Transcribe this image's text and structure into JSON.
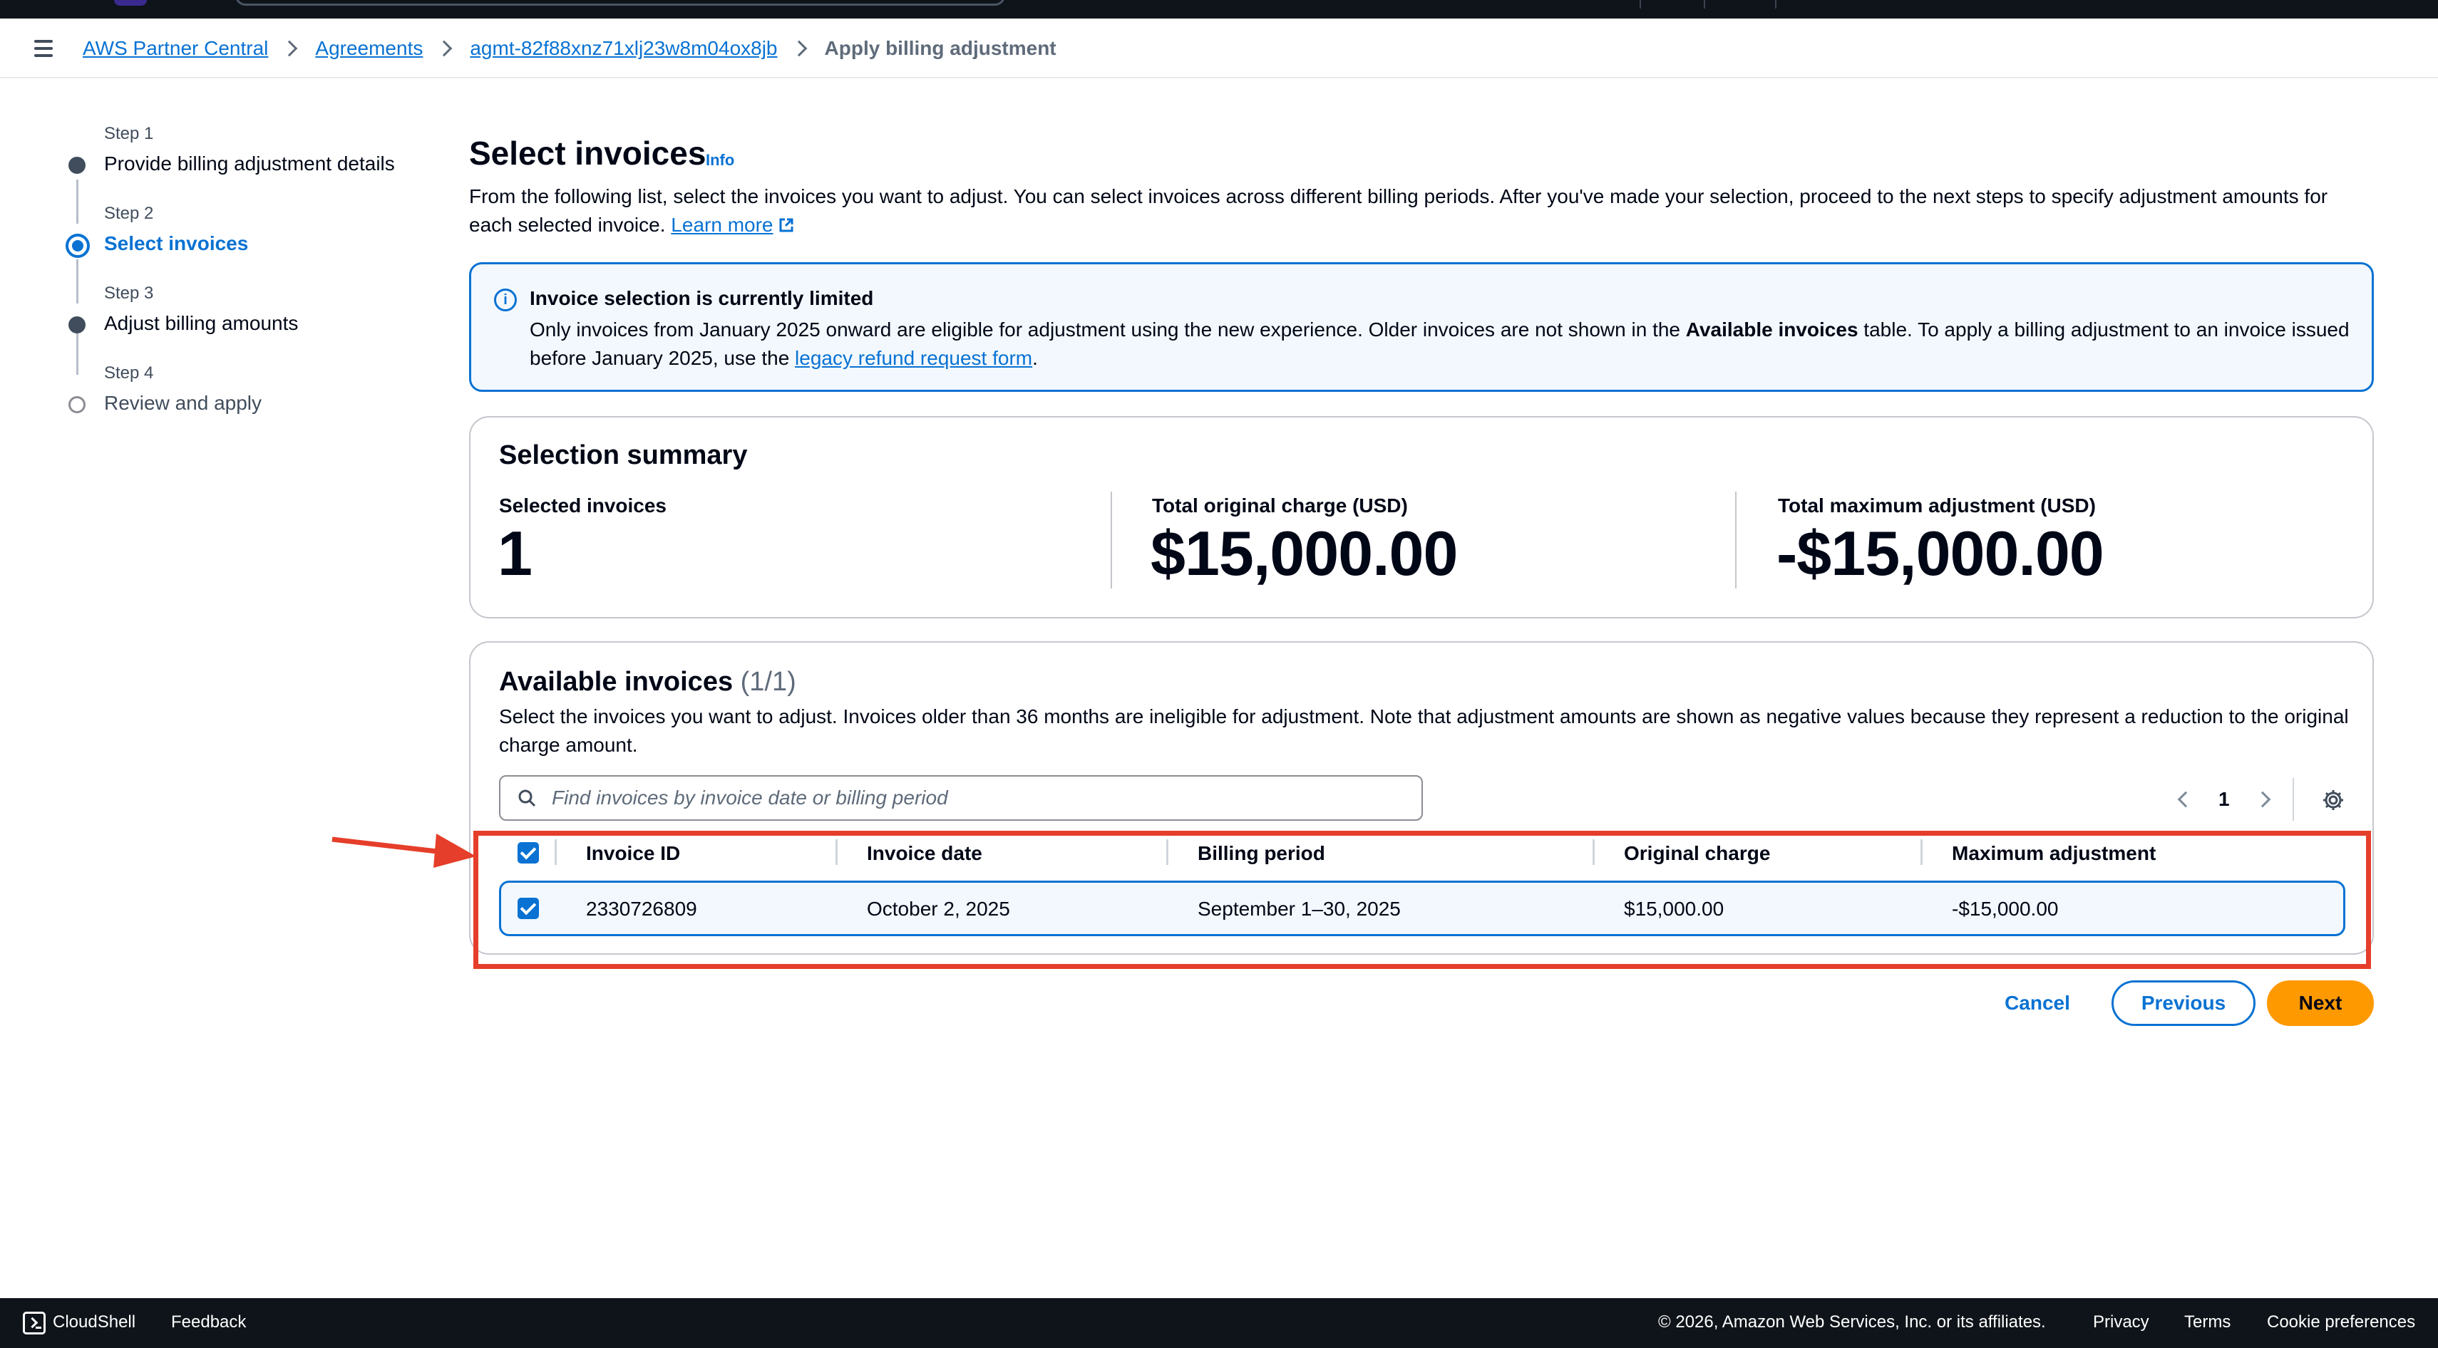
{
  "breadcrumb": {
    "items": [
      "AWS Partner Central",
      "Agreements",
      "agmt-82f88xnz71xlj23w8m04ox8jb"
    ],
    "current": "Apply billing adjustment"
  },
  "steps": [
    {
      "number": "Step 1",
      "label": "Provide billing adjustment details",
      "state": "completed"
    },
    {
      "number": "Step 2",
      "label": "Select invoices",
      "state": "active"
    },
    {
      "number": "Step 3",
      "label": "Adjust billing amounts",
      "state": "completed"
    },
    {
      "number": "Step 4",
      "label": "Review and apply",
      "state": "pending"
    }
  ],
  "page": {
    "title": "Select invoices",
    "info_link": "Info",
    "description": "From the following list, select the invoices you want to adjust. You can select invoices across different billing periods. After you've made your selection, proceed to the next steps to specify adjustment amounts for each selected invoice.",
    "learn_more": "Learn more"
  },
  "alert": {
    "title": "Invoice selection is currently limited",
    "text_before": "Only invoices from January 2025 onward are eligible for adjustment using the new experience. Older invoices are not shown in the ",
    "text_bold": "Available invoices",
    "text_middle": " table. To apply a billing adjustment to an invoice issued before January 2025, use the ",
    "link": "legacy refund request form",
    "text_after": "."
  },
  "summary": {
    "title": "Selection summary",
    "selected_label": "Selected invoices",
    "selected_value": "1",
    "total_charge_label": "Total original charge (USD)",
    "total_charge_value": "$15,000.00",
    "total_adjustment_label": "Total maximum adjustment (USD)",
    "total_adjustment_value": "-$15,000.00"
  },
  "invoices": {
    "title": "Available invoices",
    "count": "(1/1)",
    "description": "Select the invoices you want to adjust. Invoices older than 36 months are ineligible for adjustment. Note that adjustment amounts are shown as negative values because they represent a reduction to the original charge amount.",
    "search_placeholder": "Find invoices by invoice date or billing period",
    "page_number": "1",
    "columns": [
      "Invoice ID",
      "Invoice date",
      "Billing period",
      "Original charge",
      "Maximum adjustment"
    ],
    "rows": [
      {
        "invoice_id": "2330726809",
        "invoice_date": "October 2, 2025",
        "billing_period": "September 1–30, 2025",
        "original_charge": "$15,000.00",
        "maximum_adjustment": "-$15,000.00",
        "selected": true
      }
    ]
  },
  "actions": {
    "cancel": "Cancel",
    "previous": "Previous",
    "next": "Next"
  },
  "footer": {
    "cloudshell": "CloudShell",
    "feedback": "Feedback",
    "copyright": "© 2026, Amazon Web Services, Inc. or its affiliates.",
    "privacy": "Privacy",
    "terms": "Terms",
    "cookie": "Cookie preferences"
  },
  "colors": {
    "link_blue": "#0972d3",
    "primary_orange": "#ff9900",
    "annotation_red": "#e53e2a",
    "header_dark": "#0f141a"
  },
  "icons": [
    "menu-icon",
    "chevron-right-icon",
    "external-link-icon",
    "info-circle-icon",
    "search-icon",
    "chevron-left-icon",
    "settings-gear-icon",
    "checkbox-checked-icon",
    "cloudshell-icon",
    "annotation-arrow"
  ]
}
